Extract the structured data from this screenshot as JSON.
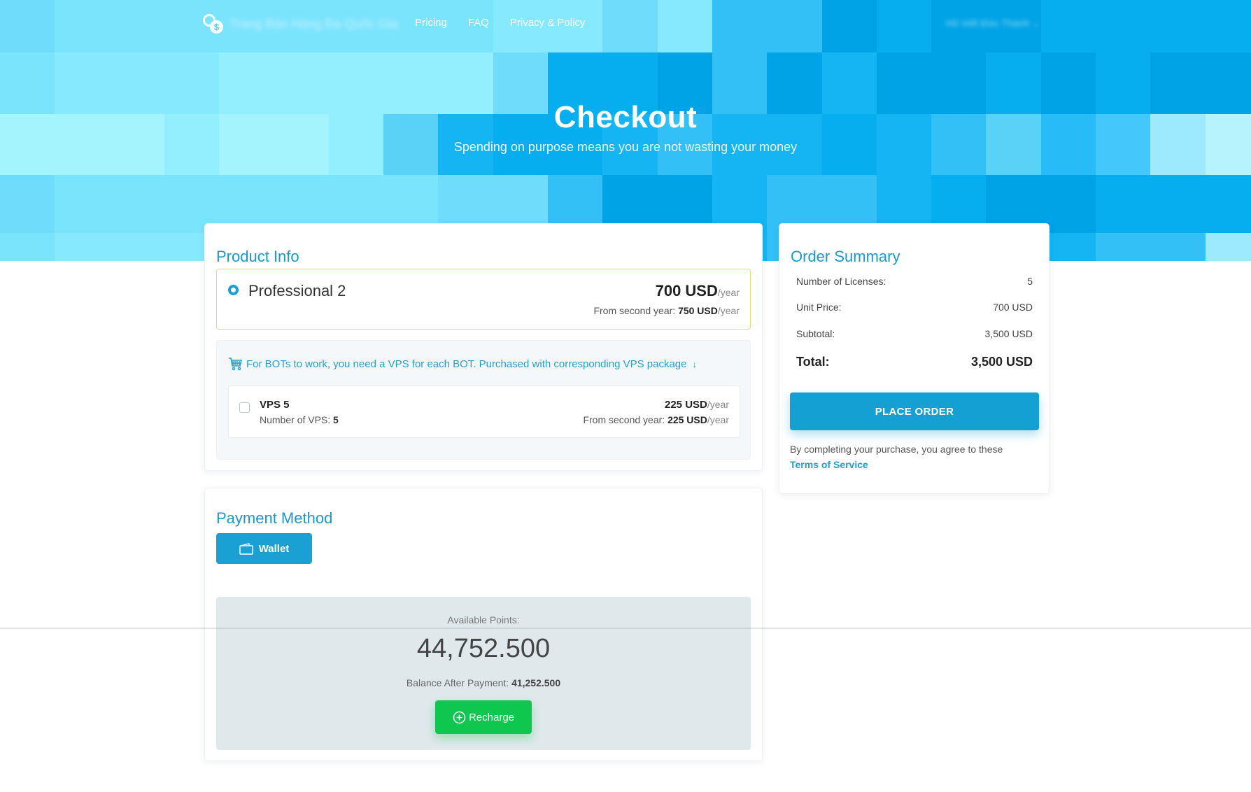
{
  "nav": {
    "brand_name": "Trang Bán Hàng Đa Quốc Gia",
    "links": [
      "Pricing",
      "FAQ",
      "Privacy & Policy"
    ],
    "user_menu": "Hồ Viết Đức Thành ⌄"
  },
  "hero": {
    "title": "Checkout",
    "subtitle": "Spending on purpose means you are not wasting your money",
    "tile_colors": [
      "#6fdcfb",
      "#7be4fd",
      "#86e9fe",
      "#93eefe",
      "#a4f4fe",
      "#5ad2f8",
      "#33c0f6",
      "#15b4f2",
      "#06aef0",
      "#00a3e6",
      "#029ee0",
      "#27bcf8",
      "#44c7fb",
      "#9de9fd",
      "#b7f3fd",
      "#cdfbfe"
    ]
  },
  "product_info": {
    "title": "Product Info",
    "plan": {
      "name": "Professional 2",
      "selected": true,
      "price": "700 USD",
      "price_unit": "/year",
      "renew_label": "From second year:",
      "renew_price": "750 USD",
      "renew_unit": "/year"
    },
    "vps_note": "For BOTs to work, you need a VPS for each BOT. Purchased with corresponding VPS package",
    "vps_note_arrow": "↓",
    "vps": {
      "name": "VPS 5",
      "checked": false,
      "count_label": "Number of VPS:",
      "count": "5",
      "price": "225 USD",
      "price_unit": "/year",
      "renew_label": "From second year:",
      "renew_price": "225 USD",
      "renew_unit": "/year"
    }
  },
  "payment": {
    "title": "Payment Method",
    "method_button": "Wallet",
    "available_label": "Available Points:",
    "available_value": "44,752.500",
    "after_label": "Balance After Payment:",
    "after_value": "41,252.500",
    "recharge_button": "Recharge"
  },
  "summary": {
    "title": "Order Summary",
    "rows": [
      {
        "label": "Number of Licenses:",
        "value": "5"
      },
      {
        "label": "Unit Price:",
        "value": "700 USD"
      },
      {
        "label": "Subtotal:",
        "value": "3,500 USD"
      }
    ],
    "total_label": "Total:",
    "total_value": "3,500 USD",
    "place_order": "PLACE ORDER",
    "terms_text": "By completing your purchase, you agree to these",
    "terms_link": "Terms of Service"
  },
  "colors": {
    "accent": "#1aa0d3",
    "title_blue": "#1f97c8",
    "recharge_green": "#0fc64f",
    "plan_border": "#f3d37a",
    "balance_bg": "#e0e8ec"
  }
}
